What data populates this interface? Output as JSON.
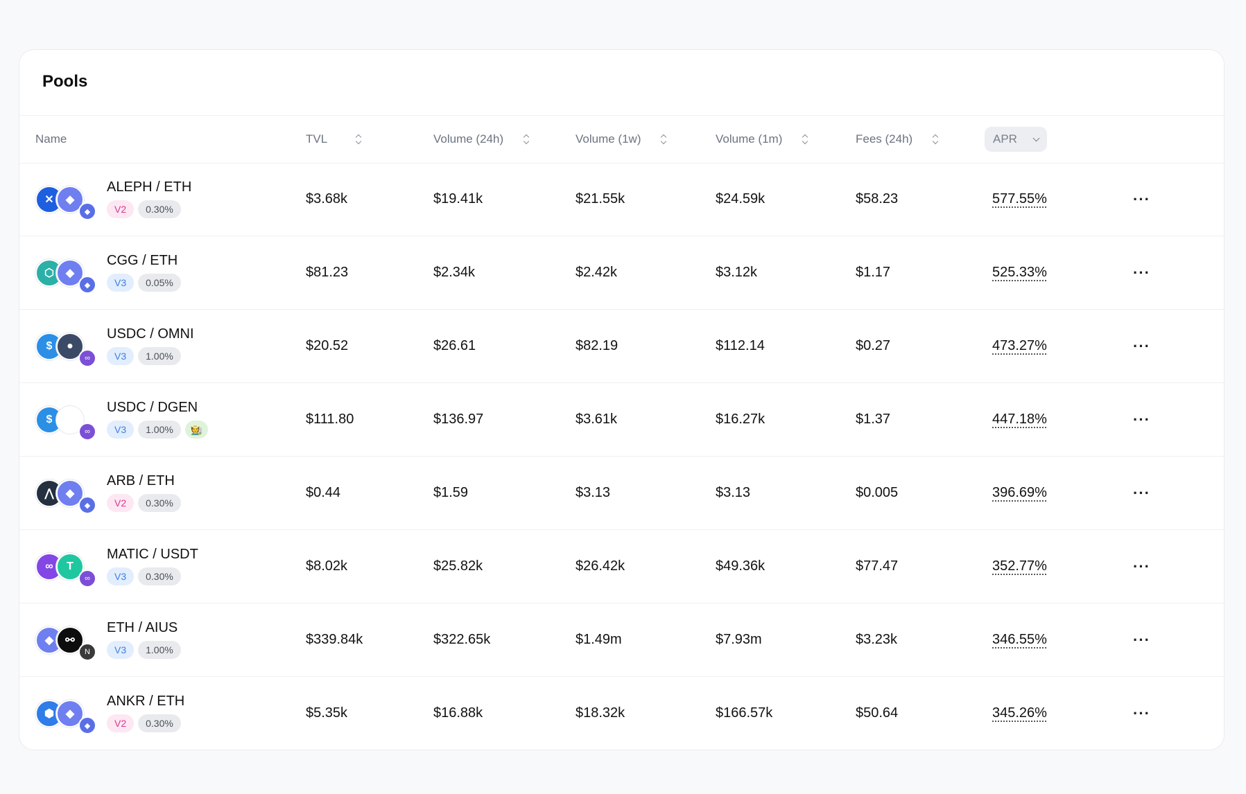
{
  "card": {
    "title": "Pools"
  },
  "columns": {
    "name": "Name",
    "tvl": "TVL",
    "vol24h": "Volume (24h)",
    "vol1w": "Volume (1w)",
    "vol1m": "Volume (1m)",
    "fees24h": "Fees (24h)",
    "apr": "APR"
  },
  "more_label": "···",
  "rows": [
    {
      "pair": "ALEPH / ETH",
      "version": "V2",
      "fee": "0.30%",
      "extra": "",
      "tvl": "$3.68k",
      "vol24h": "$19.41k",
      "vol1w": "$21.55k",
      "vol1m": "$24.59k",
      "fees24h": "$58.23",
      "apr": "577.55%",
      "icon_a": "aleph-token-icon",
      "icon_b": "eth-token-icon",
      "chain": "ethereum-chain-icon",
      "color_a": "#1e5fe0",
      "color_b": "#6f7ff0",
      "color_chain": "#5a6fe6",
      "glyph_a": "✕",
      "glyph_b": "◆",
      "glyph_chain": "◆"
    },
    {
      "pair": "CGG / ETH",
      "version": "V3",
      "fee": "0.05%",
      "extra": "",
      "tvl": "$81.23",
      "vol24h": "$2.34k",
      "vol1w": "$2.42k",
      "vol1m": "$3.12k",
      "fees24h": "$1.17",
      "apr": "525.33%",
      "icon_a": "cgg-token-icon",
      "icon_b": "eth-token-icon",
      "chain": "ethereum-chain-icon",
      "color_a": "#2bb0a8",
      "color_b": "#6f7ff0",
      "color_chain": "#5a6fe6",
      "glyph_a": "⬡",
      "glyph_b": "◆",
      "glyph_chain": "◆"
    },
    {
      "pair": "USDC / OMNI",
      "version": "V3",
      "fee": "1.00%",
      "extra": "",
      "tvl": "$20.52",
      "vol24h": "$26.61",
      "vol1w": "$82.19",
      "vol1m": "$112.14",
      "fees24h": "$0.27",
      "apr": "473.27%",
      "icon_a": "usdc-token-icon",
      "icon_b": "omni-token-icon",
      "chain": "polygon-chain-icon",
      "color_a": "#2b8fe6",
      "color_b": "#3b4a66",
      "color_chain": "#7b4fd6",
      "glyph_a": "$",
      "glyph_b": "●",
      "glyph_chain": "∞"
    },
    {
      "pair": "USDC / DGEN",
      "version": "V3",
      "fee": "1.00%",
      "extra": "🧑‍🌾",
      "tvl": "$111.80",
      "vol24h": "$136.97",
      "vol1w": "$3.61k",
      "vol1m": "$16.27k",
      "fees24h": "$1.37",
      "apr": "447.18%",
      "icon_a": "usdc-token-icon",
      "icon_b": "dgen-token-icon",
      "chain": "polygon-chain-icon",
      "color_a": "#2b8fe6",
      "color_b": "#ffffff",
      "color_chain": "#7b4fd6",
      "glyph_a": "$",
      "glyph_b": "",
      "glyph_chain": "∞"
    },
    {
      "pair": "ARB / ETH",
      "version": "V2",
      "fee": "0.30%",
      "extra": "",
      "tvl": "$0.44",
      "vol24h": "$1.59",
      "vol1w": "$3.13",
      "vol1m": "$3.13",
      "fees24h": "$0.005",
      "apr": "396.69%",
      "icon_a": "arb-token-icon",
      "icon_b": "eth-token-icon",
      "chain": "ethereum-chain-icon",
      "color_a": "#24303f",
      "color_b": "#6f7ff0",
      "color_chain": "#5a6fe6",
      "glyph_a": "⋀",
      "glyph_b": "◆",
      "glyph_chain": "◆"
    },
    {
      "pair": "MATIC / USDT",
      "version": "V3",
      "fee": "0.30%",
      "extra": "",
      "tvl": "$8.02k",
      "vol24h": "$25.82k",
      "vol1w": "$26.42k",
      "vol1m": "$49.36k",
      "fees24h": "$77.47",
      "apr": "352.77%",
      "icon_a": "matic-token-icon",
      "icon_b": "usdt-token-icon",
      "chain": "polygon-chain-icon",
      "color_a": "#8247e5",
      "color_b": "#1fc7a0",
      "color_chain": "#7b4fd6",
      "glyph_a": "∞",
      "glyph_b": "T",
      "glyph_chain": "∞"
    },
    {
      "pair": "ETH / AIUS",
      "version": "V3",
      "fee": "1.00%",
      "extra": "",
      "tvl": "$339.84k",
      "vol24h": "$322.65k",
      "vol1w": "$1.49m",
      "vol1m": "$7.93m",
      "fees24h": "$3.23k",
      "apr": "346.55%",
      "icon_a": "eth-token-icon",
      "icon_b": "aius-token-icon",
      "chain": "arbitrum-nova-chain-icon",
      "color_a": "#6f7ff0",
      "color_b": "#0d0d0d",
      "color_chain": "#3a3a3a",
      "glyph_a": "◆",
      "glyph_b": "⚯",
      "glyph_chain": "N"
    },
    {
      "pair": "ANKR / ETH",
      "version": "V2",
      "fee": "0.30%",
      "extra": "",
      "tvl": "$5.35k",
      "vol24h": "$16.88k",
      "vol1w": "$18.32k",
      "vol1m": "$166.57k",
      "fees24h": "$50.64",
      "apr": "345.26%",
      "icon_a": "ankr-token-icon",
      "icon_b": "eth-token-icon",
      "chain": "ethereum-chain-icon",
      "color_a": "#2e7de8",
      "color_b": "#6f7ff0",
      "color_chain": "#5a6fe6",
      "glyph_a": "⬢",
      "glyph_b": "◆",
      "glyph_chain": "◆"
    }
  ]
}
